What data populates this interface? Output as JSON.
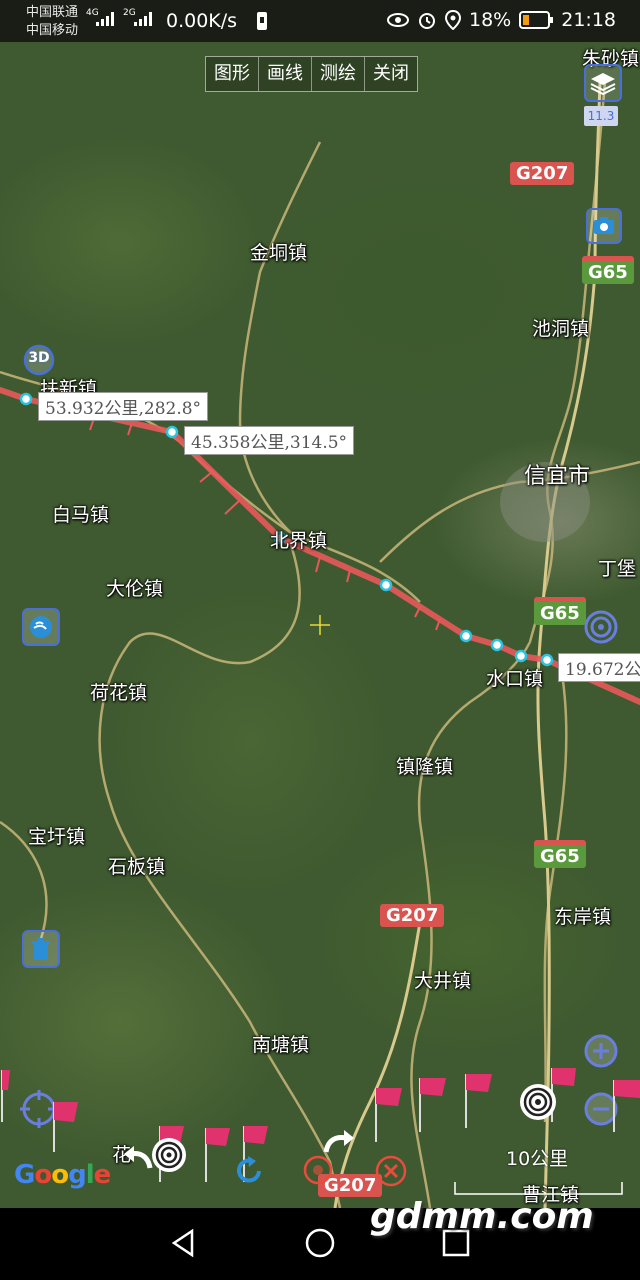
{
  "status": {
    "carrier1": "中国联通",
    "carrier2": "中国移动",
    "net1": "4G",
    "net2": "2G",
    "speed": "0.00K/s",
    "battery": "18%",
    "time": "21:18"
  },
  "toolbar": {
    "shape": "图形",
    "draw": "画线",
    "measure": "测绘",
    "close": "关闭"
  },
  "places": {
    "zhusha": "朱砂镇",
    "jintong": "金垌镇",
    "chidong": "池洞镇",
    "fuxin": "扶新镇",
    "xinyi": "信宜市",
    "baima": "白马镇",
    "beijie": "北界镇",
    "ding": "丁堡",
    "dalun": "大伦镇",
    "shuikou": "水口镇",
    "hehua": "荷花镇",
    "zhenlong": "镇隆镇",
    "baoxu": "宝圩镇",
    "shiban": "石板镇",
    "dongan": "东岸镇",
    "dajing": "大井镇",
    "nantang": "南塘镇",
    "huaxx": "花",
    "caojiang": "曹江镇"
  },
  "roads": {
    "g207": "G207",
    "g65": "G65"
  },
  "measure": {
    "seg1": "53.932公里,282.8°",
    "seg2": "45.358公里,314.5°",
    "seg3": "19.672公"
  },
  "zoom_badge": "11.3",
  "btn_3d": "3D",
  "scale": "10公里",
  "google": "Google",
  "watermark": "gdmm.com",
  "icons": [
    "layers-icon",
    "camera-icon",
    "3d-icon",
    "signal-icon",
    "trash-icon",
    "locate-icon",
    "target-icon",
    "zoom-in-icon",
    "zoom-out-icon",
    "undo-icon",
    "redo-icon",
    "clear-icon",
    "flag-icon",
    "crosshair-icon",
    "back-icon",
    "home-icon",
    "recents-icon"
  ],
  "colors": {
    "route": "#e8585a",
    "g207": "#d9534f",
    "g65": "#5a9a3c",
    "control": "#4a6fd8"
  }
}
